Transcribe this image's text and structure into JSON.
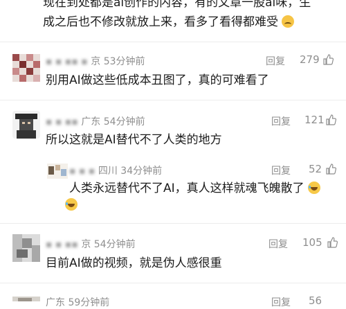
{
  "top_comment": {
    "line1": "现在到处都是ai创作的内容，有的文章一股ai味，生",
    "line2": "成之后也不修改就放上来，看多了看得都难受",
    "emoji": "persevering-face"
  },
  "comments": [
    {
      "location": "京",
      "time": "53分钟前",
      "reply": "回复",
      "likes": "279",
      "text": "别用AI做这些低成本丑图了，真的可难看了"
    },
    {
      "location": "广东",
      "time": "54分钟前",
      "reply": "回复",
      "likes": "121",
      "text": "所以这就是AI替代不了人类的地方"
    },
    {
      "location": "四川",
      "time": "34分钟前",
      "reply": "回复",
      "likes": "52",
      "text_line1": "人类永远替代不了AI，真人这样就魂飞魄散了",
      "emoji": "rolling-laughing-face"
    },
    {
      "location": "京",
      "time": "54分钟前",
      "reply": "回复",
      "likes": "105",
      "text": "目前AI做的视频，就是伪人感很重"
    }
  ],
  "partial_row": {
    "location": "广东",
    "time": "59分钟前",
    "reply": "回复",
    "likes": "56"
  }
}
